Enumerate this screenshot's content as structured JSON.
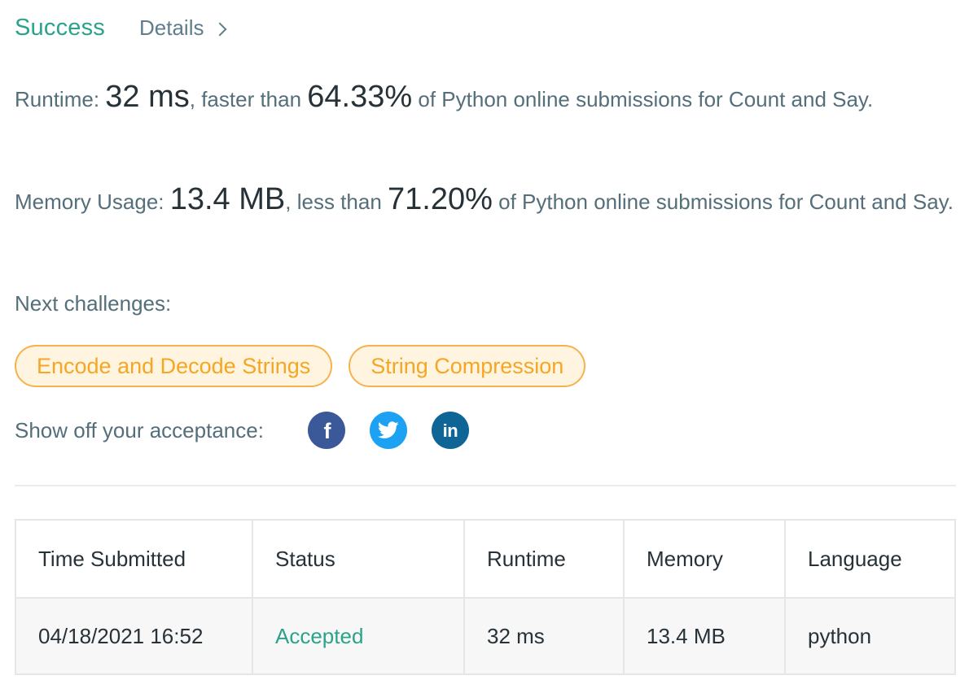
{
  "header": {
    "status": "Success",
    "details_label": "Details"
  },
  "runtime": {
    "label": "Runtime: ",
    "value": "32 ms",
    "mid": ", faster than ",
    "percent": "64.33%",
    "tail": " of Python online submissions for Count and Say."
  },
  "memory": {
    "label": "Memory Usage: ",
    "value": "13.4 MB",
    "mid": ", less than ",
    "percent": "71.20%",
    "tail": " of Python online submissions for Count and Say."
  },
  "next": {
    "label": "Next challenges:",
    "challenges": [
      "Encode and Decode Strings",
      "String Compression"
    ]
  },
  "share": {
    "label": "Show off your acceptance:",
    "icons": [
      "facebook-icon",
      "twitter-icon",
      "linkedin-icon"
    ],
    "colors": {
      "facebook": "#3b5998",
      "twitter": "#1da1f2",
      "linkedin": "#0e6596"
    }
  },
  "submissions": {
    "columns": [
      "Time Submitted",
      "Status",
      "Runtime",
      "Memory",
      "Language"
    ],
    "rows": [
      {
        "time": "04/18/2021 16:52",
        "status": "Accepted",
        "runtime": "32 ms",
        "memory": "13.4 MB",
        "language": "python"
      }
    ]
  },
  "colors": {
    "success": "#2aa38a",
    "chip_border": "#f5b24f",
    "chip_text": "#f5a623"
  }
}
